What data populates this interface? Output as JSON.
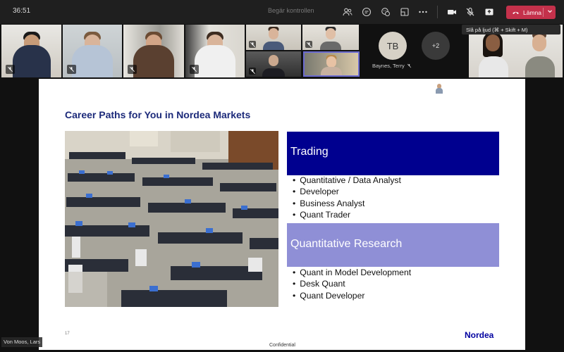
{
  "call": {
    "timer": "36:51",
    "take_control": "Begär kontrollen",
    "leave_label": "Lämna",
    "unmute_tooltip": "Slå på ljud (⌘ + Skift + M)",
    "colors": {
      "leave": "#c4314b",
      "topbar": "#1f1f1f"
    }
  },
  "toolbar": {
    "icons": [
      "people-icon",
      "chat-icon",
      "reactions-icon",
      "rooms-icon",
      "more-icon",
      "camera-icon",
      "mic-off-icon",
      "share-icon"
    ]
  },
  "participants": {
    "avatar_initials": "TB",
    "avatar_name": "Baynes, Terry",
    "overflow_count": "+2",
    "presenter_name": "Von Moos, Lars"
  },
  "slide": {
    "title": "Career Paths for You in Nordea Markets",
    "sections": [
      {
        "heading": "Trading",
        "color": "#00008f",
        "items": [
          "Quantitative / Data Analyst",
          "Developer",
          "Business Analyst",
          "Quant Trader"
        ]
      },
      {
        "heading": "Quantitative Research",
        "color": "#8f8fd6",
        "items": [
          "Quant in Model Development",
          "Desk Quant",
          "Quant Developer"
        ]
      }
    ],
    "page_number": "17",
    "brand": "Nordea",
    "footer": "Confidential"
  }
}
